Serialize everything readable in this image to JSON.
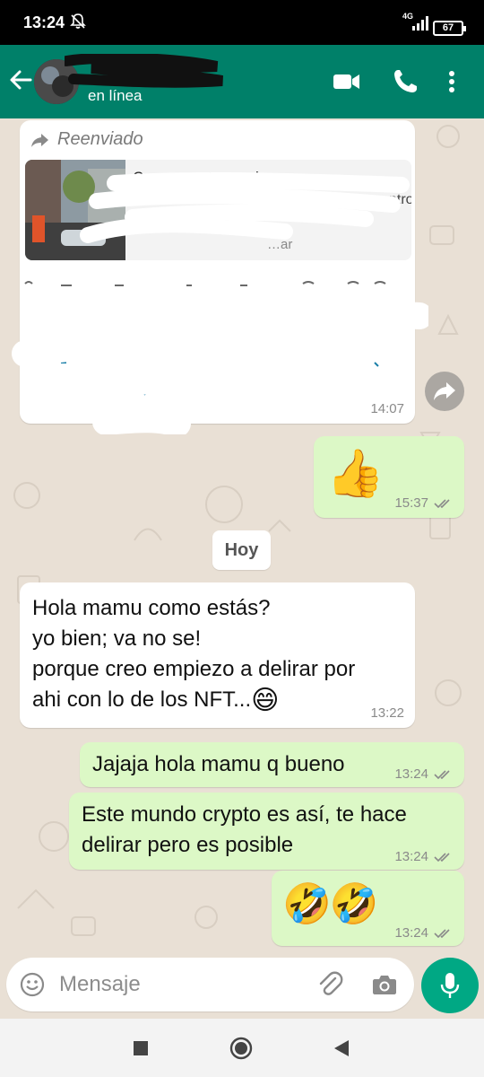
{
  "status_bar": {
    "time": "13:24",
    "network": "4G",
    "battery": "67"
  },
  "header": {
    "presence": "en línea",
    "icons": [
      "back-arrow-icon",
      "video-call-icon",
      "phone-icon",
      "more-vert-icon"
    ]
  },
  "messages": {
    "forwarded": {
      "label": "Reenviado",
      "link_title": "Com…                …ntrenomicos",
      "link_subtitle": "…ntro",
      "link_domain": "…ar",
      "time": "14:07"
    },
    "thumbs": {
      "emoji": "👍",
      "time": "15:37"
    },
    "date_chip": "Hoy",
    "incoming": {
      "lines": [
        "Hola mamu como estás?",
        "yo bien; va no se!",
        "porque creo empiezo a delirar por",
        "ahi con lo de los NFT..."
      ],
      "emoji": "😄",
      "time": "13:22"
    },
    "reply1": {
      "text": "Jajaja hola mamu q bueno",
      "time": "13:24"
    },
    "reply2": {
      "lines": [
        "Este mundo crypto es así, te hace",
        "delirar pero es posible"
      ],
      "time": "13:24"
    },
    "reply3": {
      "emoji": "🤣🤣",
      "time": "13:24"
    }
  },
  "composer": {
    "placeholder": "Mensaje"
  },
  "colors": {
    "header": "#008069",
    "outgoing": "#dcf8c6",
    "incoming": "#ffffff",
    "chat_bg": "#e9e0d5",
    "mic": "#00a884"
  }
}
